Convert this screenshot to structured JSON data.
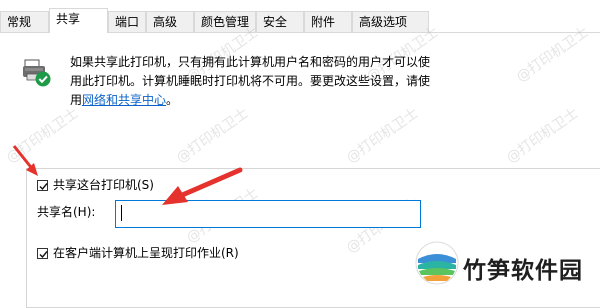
{
  "tabs": [
    {
      "label": "常规",
      "active": false
    },
    {
      "label": "共享",
      "active": true
    },
    {
      "label": "端口",
      "active": false
    },
    {
      "label": "高级",
      "active": false
    },
    {
      "label": "颜色管理",
      "active": false
    },
    {
      "label": "安全",
      "active": false
    },
    {
      "label": "附件",
      "active": false
    },
    {
      "label": "高级选项",
      "active": false
    }
  ],
  "info": {
    "line1": "如果共享此打印机，只有拥有此计算机用户名和密码的用户才可以使",
    "line2": "用此打印机。计算机睡眠时打印机将不可用。要更改这些设置，请使",
    "line3_prefix": "用",
    "line3_link": "网络和共享中心",
    "line3_suffix": "。"
  },
  "share_checkbox": {
    "label": "共享这台打印机(S)",
    "checked": true
  },
  "share_name": {
    "label": "共享名(H):",
    "value": "",
    "placeholder": ""
  },
  "render_checkbox": {
    "label": "在客户端计算机上呈现打印作业(R)",
    "checked": true
  },
  "watermark_text": "@打印机卫士",
  "logo_text": "竹笋软件园",
  "colors": {
    "accent": "#0078d7",
    "link": "#0b63c9",
    "arrow": "#e5322d",
    "tab_border": "#d9d9d9"
  },
  "icons": [
    "printer-shared-icon",
    "checkmark-icon",
    "arrow-annotation"
  ]
}
